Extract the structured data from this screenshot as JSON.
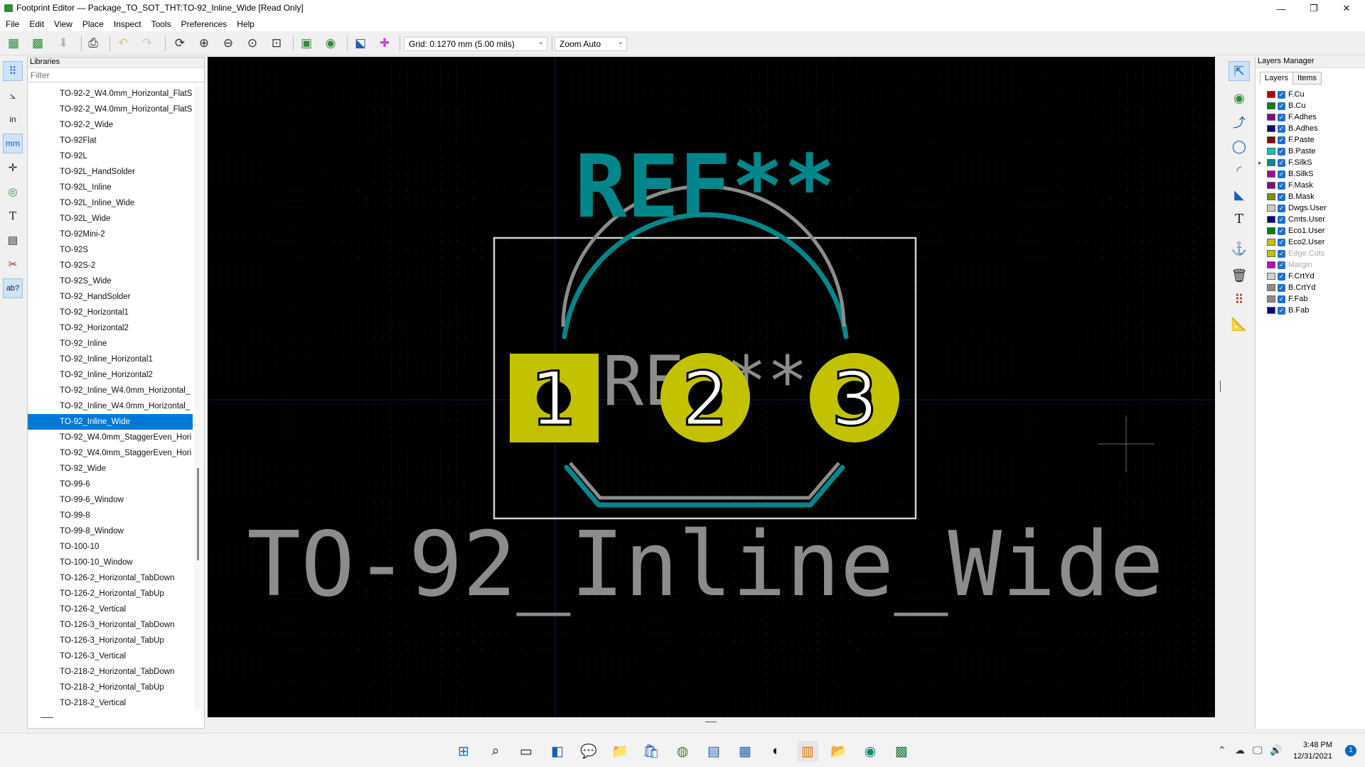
{
  "window": {
    "title": "Footprint Editor — Package_TO_SOT_THT:TO-92_Inline_Wide [Read Only]",
    "controls": [
      "—",
      "❐",
      "✕"
    ]
  },
  "menu": [
    "File",
    "Edit",
    "View",
    "Place",
    "Inspect",
    "Tools",
    "Preferences",
    "Help"
  ],
  "toolbar": {
    "grid": "Grid: 0.1270 mm (5.00 mils)",
    "zoom": "Zoom Auto"
  },
  "left_tools": {
    "units_in": "in",
    "units_mm": "mm",
    "text_tool": "T",
    "ab_label": "ab?"
  },
  "libraries": {
    "header": "Libraries",
    "filter_placeholder": "Filter",
    "items": [
      "TO-92-2_W4.0mm_Horizontal_FlatS",
      "TO-92-2_W4.0mm_Horizontal_FlatS",
      "TO-92-2_Wide",
      "TO-92Flat",
      "TO-92L",
      "TO-92L_HandSolder",
      "TO-92L_Inline",
      "TO-92L_Inline_Wide",
      "TO-92L_Wide",
      "TO-92Mini-2",
      "TO-92S",
      "TO-92S-2",
      "TO-92S_Wide",
      "TO-92_HandSolder",
      "TO-92_Horizontal1",
      "TO-92_Horizontal2",
      "TO-92_Inline",
      "TO-92_Inline_Horizontal1",
      "TO-92_Inline_Horizontal2",
      "TO-92_Inline_W4.0mm_Horizontal_",
      "TO-92_Inline_W4.0mm_Horizontal_",
      "TO-92_Inline_Wide",
      "TO-92_W4.0mm_StaggerEven_Hori",
      "TO-92_W4.0mm_StaggerEven_Hori",
      "TO-92_Wide",
      "TO-99-6",
      "TO-99-6_Window",
      "TO-99-8",
      "TO-99-8_Window",
      "TO-100-10",
      "TO-100-10_Window",
      "TO-126-2_Horizontal_TabDown",
      "TO-126-2_Horizontal_TabUp",
      "TO-126-2_Vertical",
      "TO-126-3_Horizontal_TabDown",
      "TO-126-3_Horizontal_TabUp",
      "TO-126-3_Vertical",
      "TO-218-2_Horizontal_TabDown",
      "TO-218-2_Horizontal_TabUp",
      "TO-218-2_Vertical"
    ],
    "selected_index": 21
  },
  "canvas": {
    "ref_text": "REF**",
    "ref_text_fab": "REF**",
    "value_text": "TO-92_Inline_Wide",
    "pads": [
      "1",
      "2",
      "3"
    ],
    "colors": {
      "background": "#000000",
      "silkscreen": "#00868b",
      "fab": "#8c8c8c",
      "pad": "#c2c200",
      "courtyard": "#d0d0d0"
    }
  },
  "layers": {
    "header": "Layers Manager",
    "tabs": [
      "Layers",
      "Items"
    ],
    "active_tab": "Layers",
    "list": [
      {
        "name": "F.Cu",
        "color": "#b40000",
        "dim": false
      },
      {
        "name": "B.Cu",
        "color": "#008000",
        "dim": false
      },
      {
        "name": "F.Adhes",
        "color": "#8b008b",
        "dim": false
      },
      {
        "name": "B.Adhes",
        "color": "#000080",
        "dim": false
      },
      {
        "name": "F.Paste",
        "color": "#8b0000",
        "dim": false
      },
      {
        "name": "B.Paste",
        "color": "#00c2c2",
        "dim": false
      },
      {
        "name": "F.SilkS",
        "color": "#008b8b",
        "dim": false
      },
      {
        "name": "B.SilkS",
        "color": "#a000a0",
        "dim": false
      },
      {
        "name": "F.Mask",
        "color": "#8b008b",
        "dim": false
      },
      {
        "name": "B.Mask",
        "color": "#8b8b00",
        "dim": false
      },
      {
        "name": "Dwgs.User",
        "color": "#c8c8c8",
        "dim": false
      },
      {
        "name": "Cmts.User",
        "color": "#000090",
        "dim": false
      },
      {
        "name": "Eco1.User",
        "color": "#008000",
        "dim": false
      },
      {
        "name": "Eco2.User",
        "color": "#c2c200",
        "dim": false
      },
      {
        "name": "Edge.Cuts",
        "color": "#c2c200",
        "dim": true
      },
      {
        "name": "Margin",
        "color": "#c000c0",
        "dim": true
      },
      {
        "name": "F.CrtYd",
        "color": "#d0d0d0",
        "dim": false
      },
      {
        "name": "B.CrtYd",
        "color": "#8c8c8c",
        "dim": false
      },
      {
        "name": "F.Fab",
        "color": "#8c8c8c",
        "dim": false
      },
      {
        "name": "B.Fab",
        "color": "#000090",
        "dim": false
      }
    ]
  },
  "taskbar": {
    "time": "3:48 PM",
    "date": "12/31/2021",
    "notification_count": "1"
  }
}
